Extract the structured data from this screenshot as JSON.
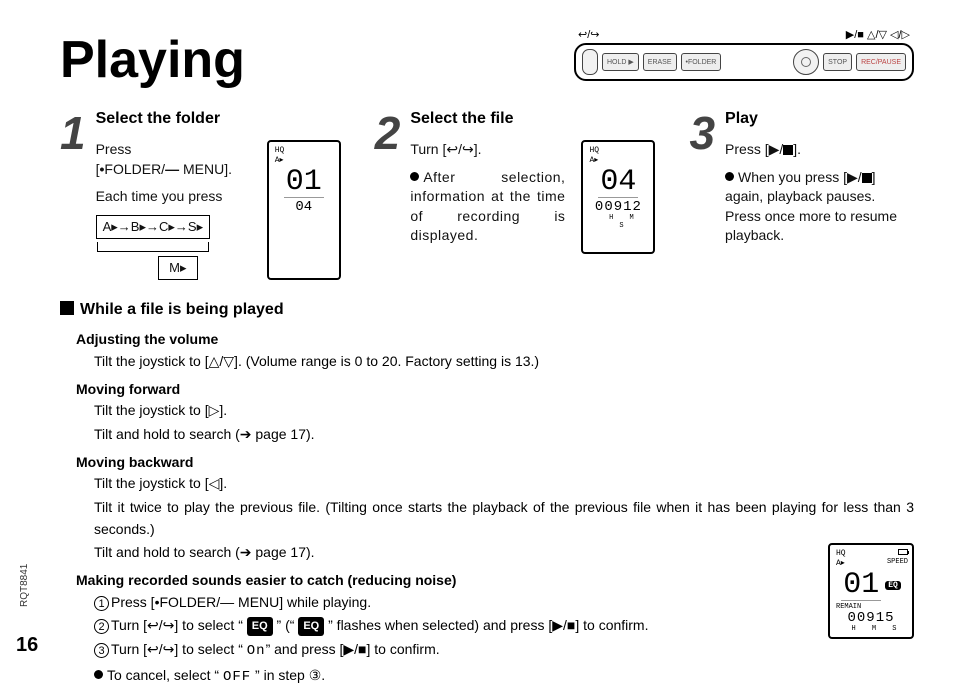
{
  "page": {
    "title": "Playing",
    "number": "16",
    "doc_id": "RQT8841"
  },
  "top_device": {
    "label_left_icon": "↩/↪",
    "label_right_icons": "▶/■   △/▽   ◁/▷",
    "buttons": {
      "hold": "HOLD ▶",
      "erase": "ERASE",
      "folder": "•FOLDER",
      "stop": "STOP",
      "recpause": "REC/PAUSE"
    }
  },
  "steps": {
    "s1": {
      "num": "1",
      "title": "Select the folder",
      "press_line": "Press\n[•FOLDER/— MENU].",
      "each_time": "Each time you press",
      "cycle_rowA": "A▸→B▸→C▸→S▸",
      "cycle_rowM": "M▸",
      "lcd": {
        "hq": "HQ",
        "a": "A▸",
        "big": "01",
        "under": "04"
      }
    },
    "s2": {
      "num": "2",
      "title": "Select the file",
      "turn": "Turn [↩/↪].",
      "note": "After selection, information at the time of recording is displayed.",
      "lcd": {
        "hq": "HQ",
        "a": "A▸",
        "big": "04",
        "under": "00912",
        "hms": "H  M  S"
      }
    },
    "s3": {
      "num": "3",
      "title": "Play",
      "press": "Press [▶/■].",
      "note": "When you press [▶/■] again, playback pauses. Press once more to resume playback."
    }
  },
  "while_playing": {
    "header": "While a file is being played",
    "adjust_vol": {
      "title": "Adjusting the volume",
      "body": "Tilt the joystick to [△/▽]. (Volume range is 0 to 20. Factory setting is 13.)"
    },
    "fwd": {
      "title": "Moving forward",
      "body1": "Tilt the joystick to [▷].",
      "body2": "Tilt and hold to search (➔ page 17)."
    },
    "bwd": {
      "title": "Moving backward",
      "body1": "Tilt the joystick to [◁].",
      "body2": "Tilt it twice to play the previous file. (Tilting once starts the playback of the previous file when it has been playing for less than 3 seconds.)",
      "body3": "Tilt and hold to search (➔ page 17)."
    },
    "noise": {
      "title": "Making recorded sounds easier to catch (reducing noise)",
      "step1": "Press [•FOLDER/— MENU] while playing.",
      "step2a": "Turn [↩/↪] to select “ ",
      "step2_eq1": "EQ",
      "step2b": " ” (“ ",
      "step2_eq2": "EQ",
      "step2c": " ” flashes when selected) and press [▶/■] to confirm.",
      "step3a": "Turn [↩/↪] to select “ ",
      "step3_on": "On",
      "step3b": "” and press [▶/■] to confirm.",
      "cancel": "To cancel, select “ ",
      "cancel_off": "OFF",
      "cancel2": " ” in step ③."
    }
  },
  "bottom_lcd": {
    "hq": "HQ",
    "speed": "SPEED",
    "a": "A▸",
    "eq": "EQ",
    "big": "01",
    "remain": "REMAIN",
    "under": "00915",
    "hms": "H  M  S"
  }
}
